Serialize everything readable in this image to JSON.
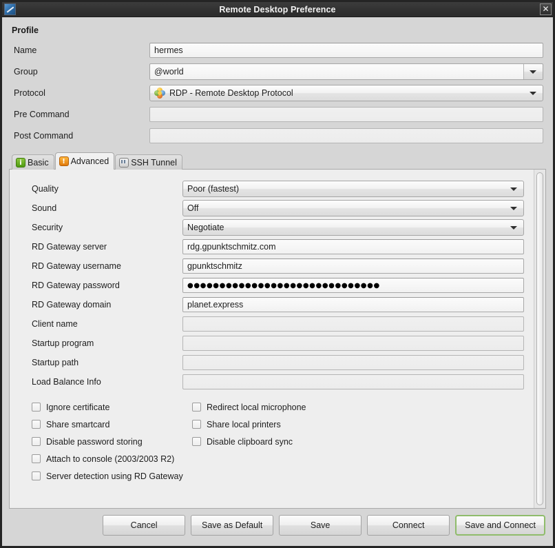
{
  "window": {
    "title": "Remote Desktop Preference",
    "icon": "remote-desktop-icon",
    "close_label": "✕"
  },
  "profile": {
    "section_title": "Profile",
    "fields": [
      {
        "label": "Name",
        "type": "entry",
        "value": "hermes",
        "placeholder": ""
      },
      {
        "label": "Group",
        "type": "combo-entry",
        "value": "@world",
        "placeholder": ""
      },
      {
        "label": "Protocol",
        "type": "combo",
        "value": "RDP - Remote Desktop Protocol",
        "icon": "protocol-rdp-icon"
      },
      {
        "label": "Pre Command",
        "type": "entry",
        "value": "",
        "placeholder": ""
      },
      {
        "label": "Post Command",
        "type": "entry",
        "value": "",
        "placeholder": ""
      }
    ]
  },
  "tabs": [
    {
      "label": "Basic",
      "icon": "info-icon",
      "icon_glyph": "i",
      "active": false
    },
    {
      "label": "Advanced",
      "icon": "warning-icon",
      "icon_glyph": "!",
      "active": true
    },
    {
      "label": "SSH Tunnel",
      "icon": "terminal-icon",
      "icon_glyph": "",
      "active": false
    }
  ],
  "advanced": {
    "fields": [
      {
        "label": "Quality",
        "type": "combo",
        "value": "Poor (fastest)"
      },
      {
        "label": "Sound",
        "type": "combo",
        "value": "Off"
      },
      {
        "label": "Security",
        "type": "combo",
        "value": "Negotiate"
      },
      {
        "label": "RD Gateway server",
        "type": "entry",
        "value": "rdg.gpunktschmitz.com"
      },
      {
        "label": "RD Gateway username",
        "type": "entry",
        "value": "gpunktschmitz"
      },
      {
        "label": "RD Gateway password",
        "type": "password",
        "value": "●●●●●●●●●●●●●●●●●●●●●●●●●●●●●●"
      },
      {
        "label": "RD Gateway domain",
        "type": "entry",
        "value": "planet.express"
      },
      {
        "label": "Client name",
        "type": "entry",
        "value": ""
      },
      {
        "label": "Startup program",
        "type": "entry",
        "value": ""
      },
      {
        "label": "Startup path",
        "type": "entry",
        "value": ""
      },
      {
        "label": "Load Balance Info",
        "type": "entry",
        "value": ""
      }
    ],
    "checkboxes": [
      {
        "label": "Ignore certificate",
        "checked": false,
        "column": "left"
      },
      {
        "label": "Redirect local microphone",
        "checked": false,
        "column": "right"
      },
      {
        "label": "Share smartcard",
        "checked": false,
        "column": "left"
      },
      {
        "label": "Share local printers",
        "checked": false,
        "column": "right"
      },
      {
        "label": "Disable password storing",
        "checked": false,
        "column": "left"
      },
      {
        "label": "Disable clipboard sync",
        "checked": false,
        "column": "right"
      },
      {
        "label": "Attach to console (2003/2003 R2)",
        "checked": false,
        "column": "left"
      },
      {
        "label": "",
        "checked": false,
        "column": "right"
      },
      {
        "label": "Server detection using RD Gateway",
        "checked": false,
        "column": "left"
      },
      {
        "label": "",
        "checked": false,
        "column": "right"
      }
    ]
  },
  "buttons": [
    {
      "label": "Cancel",
      "focused": false
    },
    {
      "label": "Save as Default",
      "focused": false
    },
    {
      "label": "Save",
      "focused": false
    },
    {
      "label": "Connect",
      "focused": false
    },
    {
      "label": "Save and Connect",
      "focused": true
    }
  ],
  "colors": {
    "focus_border": "#8fbc6b",
    "titlebar": "#323232",
    "dialog_bg": "#d6d6d6",
    "panel_bg": "#eeeeee"
  }
}
